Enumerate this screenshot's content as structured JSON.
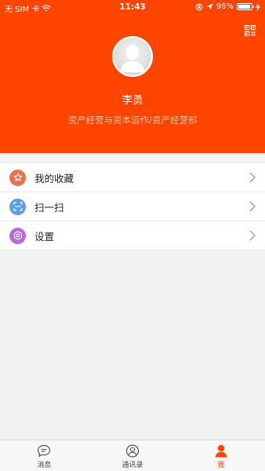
{
  "status_bar": {
    "carrier": "无 SIM 卡",
    "time": "11:43",
    "battery_pct": "96%",
    "battery_level": 0.96
  },
  "profile": {
    "name": "李勇",
    "department": "资产经营与资本运作/资产经营部"
  },
  "menu": {
    "items": [
      {
        "label": "我的收藏",
        "icon": "star-icon",
        "color": "#e8744f"
      },
      {
        "label": "扫一扫",
        "icon": "scan-icon",
        "color": "#5b9ee8"
      },
      {
        "label": "设置",
        "icon": "settings-gear-icon",
        "color": "#b86ad6"
      }
    ]
  },
  "tabbar": {
    "tabs": [
      {
        "label": "消息",
        "icon": "chat-bubble-icon"
      },
      {
        "label": "通讯录",
        "icon": "contacts-icon"
      },
      {
        "label": "我",
        "icon": "person-icon",
        "active": true
      }
    ]
  },
  "colors": {
    "brand": "#ff4500",
    "header_subtext": "#ffc9b0"
  }
}
